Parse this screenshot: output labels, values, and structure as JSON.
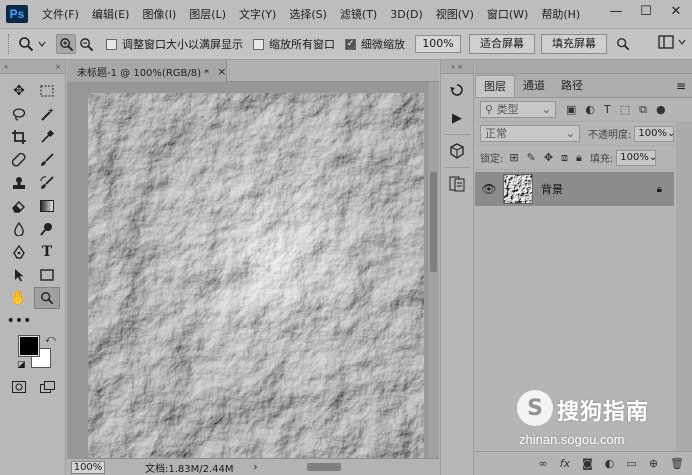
{
  "app": {
    "logo": "Ps"
  },
  "menu": [
    "文件(F)",
    "编辑(E)",
    "图像(I)",
    "图层(L)",
    "文字(Y)",
    "选择(S)",
    "滤镜(T)",
    "3D(D)",
    "视图(V)",
    "窗口(W)",
    "帮助(H)"
  ],
  "window_controls": {
    "minimize": "—",
    "maximize": "☐",
    "close": "✕"
  },
  "options": {
    "resize_windows_label": "调整窗口大小以满屏显示",
    "resize_windows_checked": false,
    "zoom_all_label": "缩放所有窗口",
    "zoom_all_checked": false,
    "scrubby_zoom_label": "细微缩放",
    "scrubby_zoom_checked": true,
    "zoom_percent": "100%",
    "fit_screen_label": "适合屏幕",
    "fill_screen_label": "填充屏幕"
  },
  "document": {
    "tab_title": "未标题-1 @ 100%(RGB/8) *",
    "close_glyph": "×",
    "status_zoom": "100%",
    "status_info": "文档:1.83M/2.44M"
  },
  "layers_panel": {
    "tabs": [
      "图层",
      "通道",
      "路径"
    ],
    "active_tab": "图层",
    "filter_kind": "类型",
    "blend_mode": "正常",
    "opacity_label": "不透明度:",
    "opacity_value": "100%",
    "lock_label": "锁定:",
    "fill_label": "填充:",
    "fill_value": "100%",
    "layers": [
      {
        "name": "背景",
        "visible": true,
        "locked": true
      }
    ]
  },
  "watermark": {
    "brand": "搜狗指南",
    "url": "zhinan.sogou.com"
  },
  "colors": {
    "foreground": "#000000",
    "background": "#ffffff",
    "ps_logo_bg": "#0b2a49",
    "ps_logo_text": "#3fa7ff"
  },
  "icons": {
    "tools": [
      "move-icon",
      "marquee-icon",
      "lasso-icon",
      "magic-wand-icon",
      "crop-icon",
      "eyedropper-icon",
      "spot-healing-icon",
      "brush-icon",
      "stamp-icon",
      "history-brush-icon",
      "eraser-icon",
      "gradient-icon",
      "blur-icon",
      "dodge-icon",
      "pen-icon",
      "type-icon",
      "path-selection-icon",
      "rectangle-icon",
      "hand-icon",
      "zoom-icon"
    ]
  }
}
